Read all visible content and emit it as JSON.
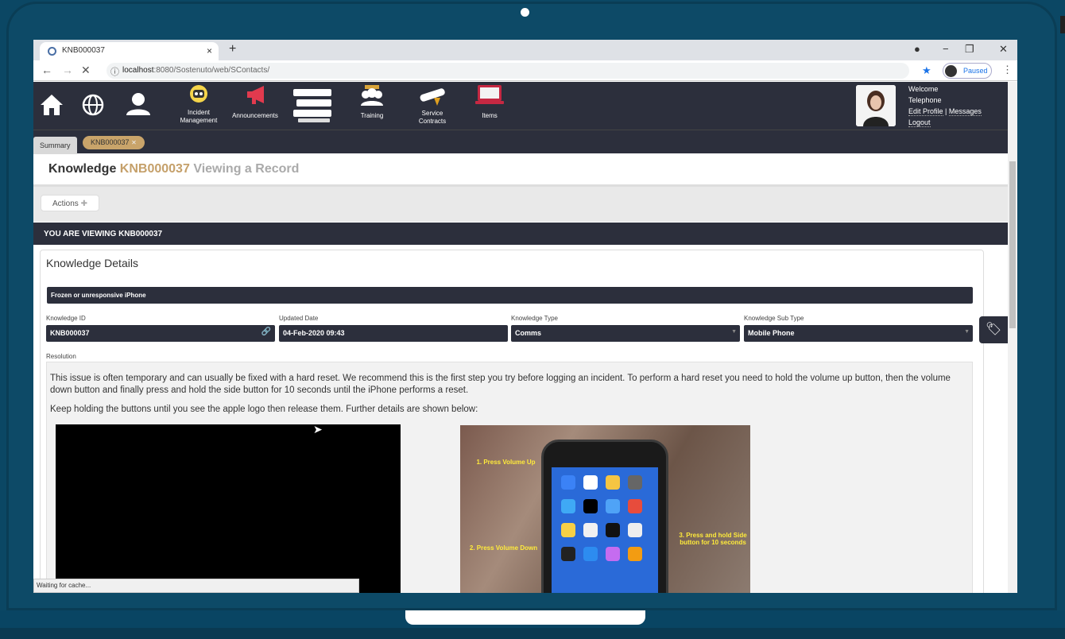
{
  "browser": {
    "tab_title": "KNB000037",
    "tab_close": "×",
    "new_tab": "+",
    "url_host": "localhost",
    "url_rest": ":8080/Sostenuto/web/SContacts/",
    "profile_status": "Paused",
    "status_bar": "Waiting for cache..."
  },
  "nav": {
    "incident_label": "Incident Management",
    "announcements_label": "Announcements",
    "training_label": "Training",
    "service_contracts_label": "Service Contracts",
    "items_label": "Items"
  },
  "user": {
    "welcome": "Welcome",
    "name": "Telephone",
    "edit_profile": "Edit Profile",
    "separator": "|",
    "messages": "Messages",
    "logout": "Logout"
  },
  "tabs": {
    "summary": "Summary",
    "record": "KNB000037"
  },
  "page": {
    "title_prefix": "Knowledge",
    "title_id": "KNB000037",
    "title_suffix": "Viewing a Record",
    "actions": "Actions",
    "viewing_banner": "YOU ARE VIEWING KNB000037"
  },
  "details": {
    "section_title": "Knowledge Details",
    "topic": "Frozen or unresponsive iPhone",
    "fields": {
      "knowledge_id_label": "Knowledge ID",
      "knowledge_id": "KNB000037",
      "updated_date_label": "Updated Date",
      "updated_date": "04-Feb-2020 09:43",
      "knowledge_type_label": "Knowledge Type",
      "knowledge_type": "Comms",
      "knowledge_sub_type_label": "Knowledge Sub Type",
      "knowledge_sub_type": "Mobile Phone"
    },
    "resolution_label": "Resolution",
    "resolution_p1": "This issue is often temporary and can usually be fixed with a hard reset. We recommend this is the first step you try before logging an incident. To perform a hard reset you need to hold the volume up button, then the volume down button and finally press and hold the side button for 10 seconds until the iPhone performs a reset.",
    "resolution_p2": "Keep holding the buttons until you see the apple logo then release them. Further details are shown below:",
    "image_labels": {
      "step1": "1. Press Volume Up",
      "step2": "2. Press Volume Down",
      "step3": "3. Press and hold Side button for 10 seconds"
    }
  },
  "colors": {
    "header_bg": "#2c2f3c",
    "accent_gold": "#c5a06a",
    "frame": "#0d4a67"
  }
}
